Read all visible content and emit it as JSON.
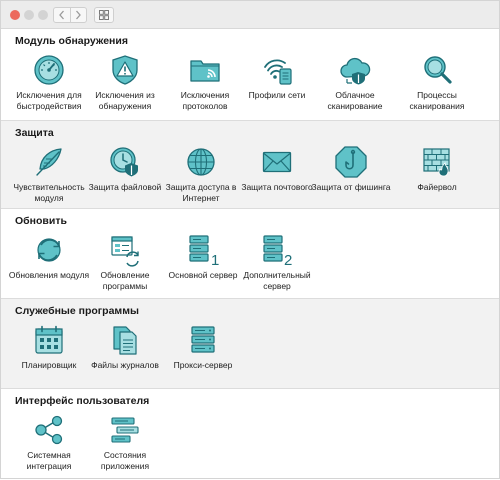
{
  "sections": [
    {
      "title": "Модуль обнаружения",
      "items": [
        {
          "label": "Исключения для быстродействия",
          "icon": "speedometer-icon"
        },
        {
          "label": "Исключения из обнаружения",
          "icon": "warning-shield-icon"
        },
        {
          "label": "Исключения протоколов",
          "icon": "folder-wave-icon"
        },
        {
          "label": "Профили сети",
          "icon": "network-profile-icon"
        },
        {
          "label": "Облачное сканирование",
          "icon": "cloud-shield-icon"
        },
        {
          "label": "Процессы сканирования",
          "icon": "magnifier-icon"
        }
      ]
    },
    {
      "title": "Защита",
      "items": [
        {
          "label": "Чувствительность модуля",
          "icon": "feather-icon"
        },
        {
          "label": "Защита файловой",
          "icon": "clock-shield-icon"
        },
        {
          "label": "Защита доступа в Интернет",
          "icon": "globe-icon"
        },
        {
          "label": "Защита почтового",
          "icon": "envelope-icon"
        },
        {
          "label": "Защита от фишинга",
          "icon": "hook-icon"
        },
        {
          "label": "Файервол",
          "icon": "firewall-icon"
        }
      ]
    },
    {
      "title": "Обновить",
      "items": [
        {
          "label": "Обновления модуля",
          "icon": "refresh-globe-icon"
        },
        {
          "label": "Обновление программы",
          "icon": "app-update-icon"
        },
        {
          "label": "Основной сервер",
          "icon": "server-1-icon"
        },
        {
          "label": "Дополнительный сервер",
          "icon": "server-2-icon"
        }
      ]
    },
    {
      "title": "Служебные программы",
      "items": [
        {
          "label": "Планировщик",
          "icon": "calendar-icon"
        },
        {
          "label": "Файлы журналов",
          "icon": "log-files-icon"
        },
        {
          "label": "Прокси-сервер",
          "icon": "proxy-server-icon"
        }
      ]
    },
    {
      "title": "Интерфейс пользователя",
      "items": [
        {
          "label": "Системная интеграция",
          "icon": "share-nodes-icon"
        },
        {
          "label": "Состояния приложения",
          "icon": "status-list-icon"
        }
      ]
    }
  ],
  "colors": {
    "icon_stroke": "#1f6f78",
    "icon_fill": "#5fc2c8",
    "icon_fill_light": "#a7dfe2",
    "close": "#ec6a5e"
  }
}
